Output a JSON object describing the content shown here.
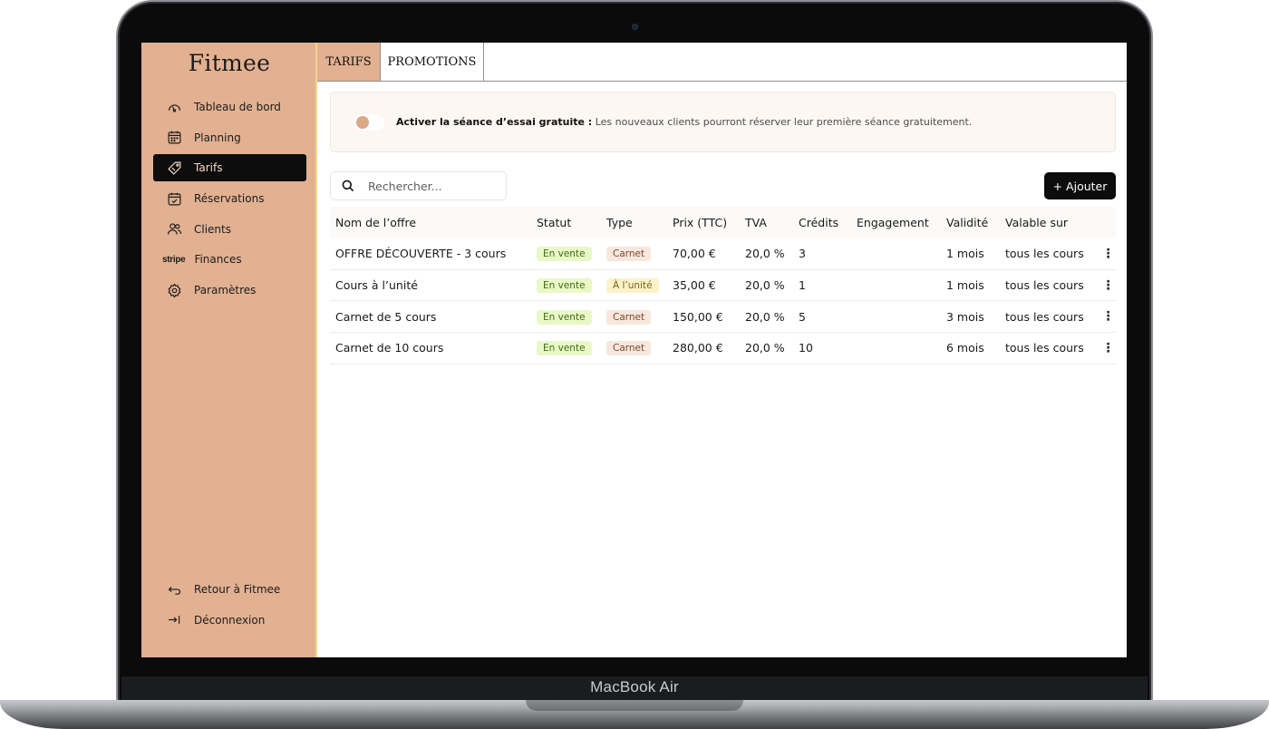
{
  "device": {
    "brand": "MacBook Air"
  },
  "sidebar": {
    "logo": "Fitmee",
    "items": [
      {
        "label": "Tableau de bord",
        "icon": "gauge-icon"
      },
      {
        "label": "Planning",
        "icon": "calendar-icon"
      },
      {
        "label": "Tarifs",
        "icon": "price-tag-icon",
        "active": true
      },
      {
        "label": "Réservations",
        "icon": "calendar-check-icon"
      },
      {
        "label": "Clients",
        "icon": "users-icon"
      },
      {
        "label": "Finances",
        "icon": "stripe-icon",
        "icon_text": "stripe"
      },
      {
        "label": "Paramètres",
        "icon": "gear-icon"
      }
    ],
    "bottom_items": [
      {
        "label": "Retour à Fitmee",
        "icon": "return-arrow-icon"
      },
      {
        "label": "Déconnexion",
        "icon": "logout-arrow-icon"
      }
    ],
    "colors": {
      "background": "#e2b191",
      "active_bg": "#0d0d0d"
    }
  },
  "tabs": [
    {
      "label": "TARIFS",
      "active": true
    },
    {
      "label": "PROMOTIONS",
      "active": false
    }
  ],
  "trial": {
    "label": "Activer la séance d’essai gratuite :",
    "description": "Les nouveaux clients pourront réserver leur première séance gratuitement.",
    "enabled": false
  },
  "search": {
    "placeholder": "Rechercher..."
  },
  "add_button": {
    "label": "+ Ajouter"
  },
  "table": {
    "headers": [
      "Nom de l’offre",
      "Statut",
      "Type",
      "Prix (TTC)",
      "TVA",
      "Crédits",
      "Engagement",
      "Validité",
      "Valable sur"
    ],
    "rows": [
      {
        "name": "OFFRE DÉCOUVERTE - 3 cours",
        "status": "En vente",
        "type": "Carnet",
        "price": "70,00 €",
        "vat": "20,0 %",
        "credits": "3",
        "engagement": "",
        "validity": "1 mois",
        "valid_on": "tous les cours"
      },
      {
        "name": "Cours à l’unité",
        "status": "En vente",
        "type": "À l’unité",
        "price": "35,00 €",
        "vat": "20,0 %",
        "credits": "1",
        "engagement": "",
        "validity": "1 mois",
        "valid_on": "tous les cours"
      },
      {
        "name": "Carnet de 5 cours",
        "status": "En vente",
        "type": "Carnet",
        "price": "150,00 €",
        "vat": "20,0 %",
        "credits": "5",
        "engagement": "",
        "validity": "3 mois",
        "valid_on": "tous les cours"
      },
      {
        "name": "Carnet de 10 cours",
        "status": "En vente",
        "type": "Carnet",
        "price": "280,00 €",
        "vat": "20,0 %",
        "credits": "10",
        "engagement": "",
        "validity": "6 mois",
        "valid_on": "tous les cours"
      }
    ]
  }
}
